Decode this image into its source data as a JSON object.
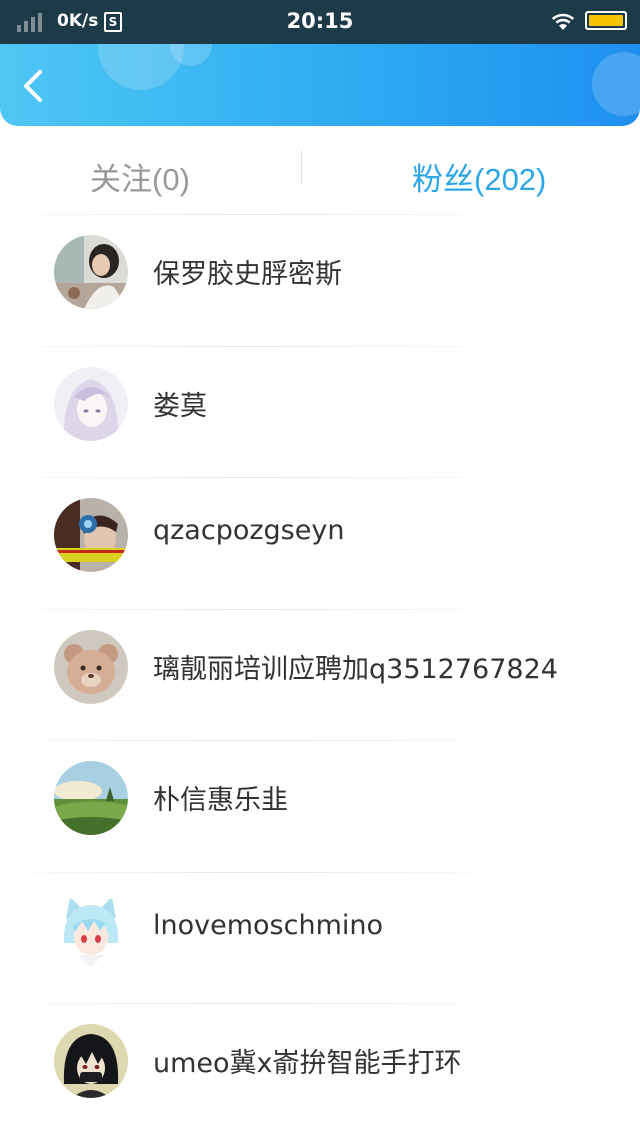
{
  "status_bar": {
    "speed": "0K/s",
    "sim_label": "S",
    "time": "20:15",
    "icons": [
      "signal-icon",
      "wifi-icon",
      "battery-icon"
    ],
    "battery_color": "#f7c400"
  },
  "header": {
    "back_icon": "chevron-left-icon",
    "gradient": [
      "#4fc7f3",
      "#1f8ff0"
    ]
  },
  "tabs": {
    "following": "关注(0)",
    "followers": "粉丝(202)",
    "active": "followers",
    "active_color": "#2ba6e8",
    "inactive_color": "#999999"
  },
  "followers": [
    {
      "name": "保罗胶史脬密斯",
      "avatar": "avatar-girl-photo"
    },
    {
      "name": "娄莫",
      "avatar": "avatar-anime-sketch"
    },
    {
      "name": "qzacpozgseyn",
      "avatar": "avatar-person-photo"
    },
    {
      "name": "璃靓丽培训应聘加q3512767824",
      "avatar": "avatar-teddy-bear"
    },
    {
      "name": "朴信惠乐韭",
      "avatar": "avatar-landscape"
    },
    {
      "name": "lnovemoschmino",
      "avatar": "avatar-anime-catboy"
    },
    {
      "name": "umeo冀x嵛拚智能手打环",
      "avatar": "avatar-anime-dark-hair"
    }
  ]
}
